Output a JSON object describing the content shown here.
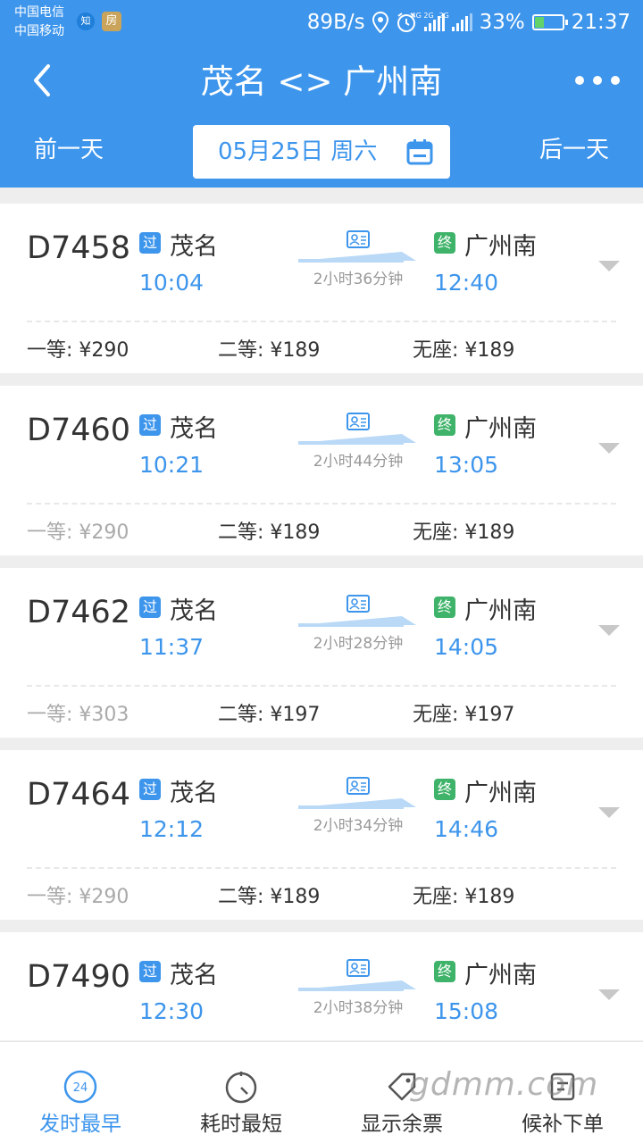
{
  "status_bar": {
    "carrier1": "中国电信",
    "carrier2": "中国移动",
    "badge1": "知",
    "badge2": "房",
    "net_speed": "89B/s",
    "sig1_label": "4G 2G",
    "sig2_label": "2G",
    "battery": "33%",
    "time": "21:37"
  },
  "header": {
    "title": "茂名 <> 广州南",
    "prev_day": "前一天",
    "next_day": "后一天",
    "date": "05月25日 周六"
  },
  "trains": [
    {
      "no": "D7458",
      "pass_tag": "过",
      "from": "茂名",
      "dep": "10:04",
      "end_tag": "终",
      "to": "广州南",
      "arr": "12:40",
      "duration": "2小时36分钟",
      "prices": [
        "一等: ¥290",
        "二等: ¥189",
        "无座: ¥189"
      ],
      "sold": [
        false,
        false,
        false
      ]
    },
    {
      "no": "D7460",
      "pass_tag": "过",
      "from": "茂名",
      "dep": "10:21",
      "end_tag": "终",
      "to": "广州南",
      "arr": "13:05",
      "duration": "2小时44分钟",
      "prices": [
        "一等: ¥290",
        "二等: ¥189",
        "无座: ¥189"
      ],
      "sold": [
        true,
        false,
        false
      ]
    },
    {
      "no": "D7462",
      "pass_tag": "过",
      "from": "茂名",
      "dep": "11:37",
      "end_tag": "终",
      "to": "广州南",
      "arr": "14:05",
      "duration": "2小时28分钟",
      "prices": [
        "一等: ¥303",
        "二等: ¥197",
        "无座: ¥197"
      ],
      "sold": [
        true,
        false,
        false
      ]
    },
    {
      "no": "D7464",
      "pass_tag": "过",
      "from": "茂名",
      "dep": "12:12",
      "end_tag": "终",
      "to": "广州南",
      "arr": "14:46",
      "duration": "2小时34分钟",
      "prices": [
        "一等: ¥290",
        "二等: ¥189",
        "无座: ¥189"
      ],
      "sold": [
        true,
        false,
        false
      ]
    },
    {
      "no": "D7490",
      "pass_tag": "过",
      "from": "茂名",
      "dep": "12:30",
      "end_tag": "终",
      "to": "广州南",
      "arr": "15:08",
      "duration": "2小时38分钟",
      "prices": [],
      "sold": []
    }
  ],
  "bottom_nav": {
    "earliest": "发时最早",
    "earliest_icon_text": "24",
    "shortest": "耗时最短",
    "remaining": "显示余票",
    "waitlist": "候补下单"
  },
  "watermark": "gdmm.com",
  "colors": {
    "primary": "#3d95ec",
    "end_tag": "#3fb36a",
    "sold_text": "#aaaaaa"
  }
}
